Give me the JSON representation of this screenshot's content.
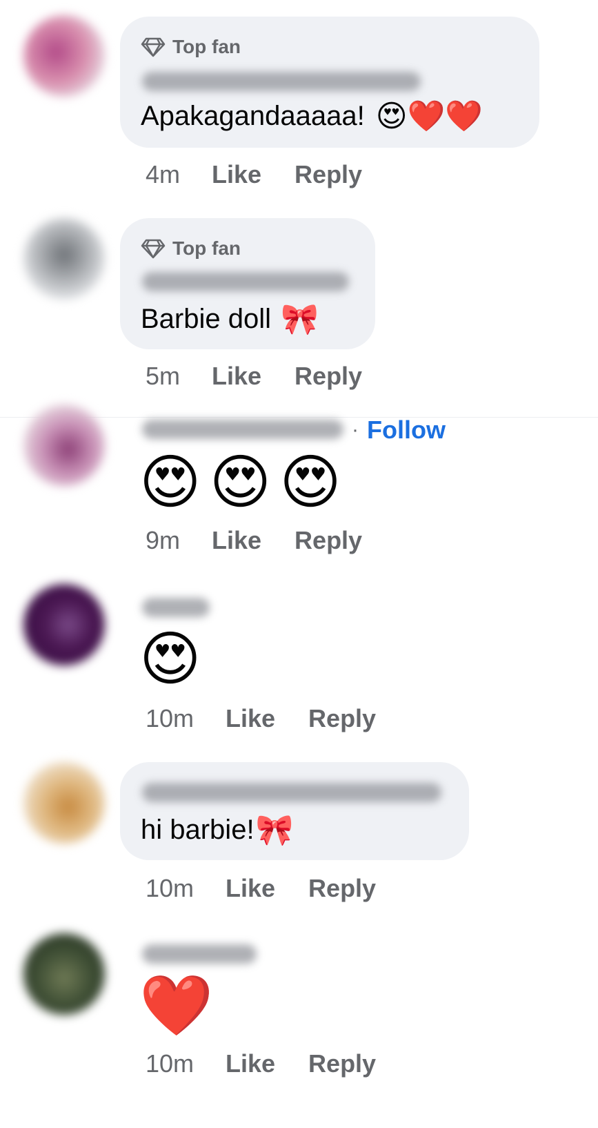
{
  "comments": [
    {
      "badge": "Top fan",
      "text": "Apakagandaaaaa!",
      "emojis": "😍❤️❤️",
      "time": "4m",
      "like": "Like",
      "reply": "Reply",
      "avatar_color": "#c7738f"
    },
    {
      "badge": "Top fan",
      "text": "Barbie doll",
      "emojis": "🎀",
      "time": "5m",
      "like": "Like",
      "reply": "Reply",
      "avatar_color": "#cfd2d6"
    },
    {
      "follow": "Follow",
      "follow_sep": "·",
      "emojis": "😍😍😍",
      "time": "9m",
      "like": "Like",
      "reply": "Reply",
      "avatar_color": "#b98fb0"
    },
    {
      "emojis": "😍",
      "time": "10m",
      "like": "Like",
      "reply": "Reply",
      "avatar_color": "#4a1752"
    },
    {
      "text": "hi barbie!",
      "emojis": "🎀",
      "time": "10m",
      "like": "Like",
      "reply": "Reply",
      "avatar_color": "#d8a870"
    },
    {
      "emojis": "❤️",
      "time": "10m",
      "like": "Like",
      "reply": "Reply",
      "avatar_color": "#3f4f35"
    }
  ],
  "colors": {
    "bubble": "#eff1f5",
    "meta_text": "#65676b",
    "follow_link": "#1b6fe0"
  }
}
